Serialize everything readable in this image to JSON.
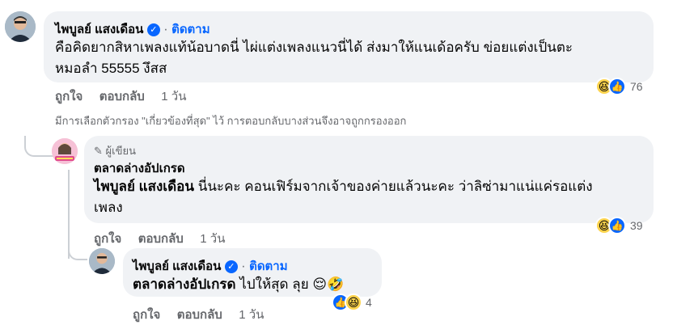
{
  "comment1": {
    "author": "ไพบูลย์ แสงเดือน",
    "follow": "ติดตาม",
    "text_line1": "คือคิดยากสิหาเพลงแท้น้อบาดนี่ ไผ่แต่งเพลงแนวนี่ได้ ส่งมาให้แนเด้อครับ ข่อยแต่งเป็นตะ",
    "text_line2": "หมอลำ 55555 งึสส",
    "like": "ถูกใจ",
    "reply": "ตอบกลับ",
    "time": "1 วัน",
    "reaction_count": "76"
  },
  "filter_notice": "มีการเลือกตัวกรอง \"เกี่ยวข้องที่สุด\" ไว้ การตอบกลับบางส่วนจึงอาจถูกกรองออก",
  "comment2": {
    "badge": "ผู้เขียน",
    "author": "ตลาดล่างอัปเกรด",
    "mention": "ไพบูลย์ แสงเดือน",
    "text_line1_rest": " นี่นะคะ คอนเฟิร์มจากเจ้าของค่ายแล้วนะคะ ว่าลิซ่ามาแน่แค่รอแต่ง",
    "text_line2": "เพลง",
    "like": "ถูกใจ",
    "reply": "ตอบกลับ",
    "time": "1 วัน",
    "reaction_count": "39"
  },
  "comment3": {
    "author": "ไพบูลย์ แสงเดือน",
    "follow": "ติดตาม",
    "mention": "ตลาดล่างอัปเกรด",
    "text_rest": " ไปให้สุด ลุย 😌🤣",
    "like": "ถูกใจ",
    "reply": "ตอบกลับ",
    "time": "1 วัน",
    "reaction_count": "4"
  },
  "colors": {
    "link": "#0866ff",
    "bubble": "#f0f2f5",
    "meta": "#65676b"
  },
  "icons": [
    "verified-icon",
    "pencil-icon",
    "like-reaction-icon",
    "haha-reaction-icon"
  ]
}
